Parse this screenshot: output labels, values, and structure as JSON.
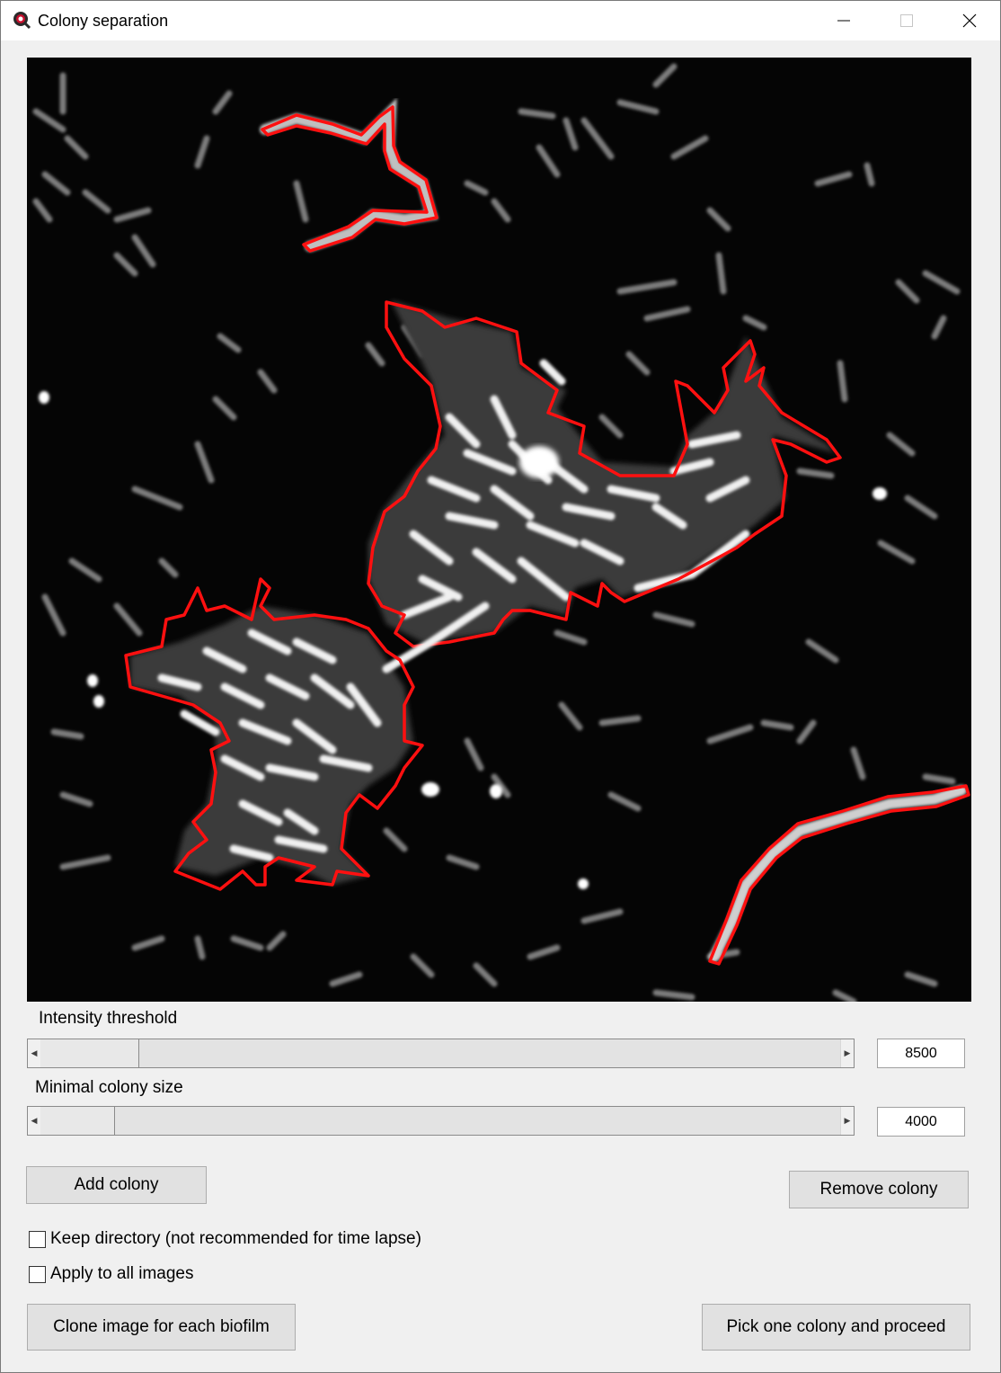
{
  "window": {
    "title": "Colony separation",
    "minimize_icon": "minimize-icon",
    "maximize_icon": "maximize-icon",
    "close_icon": "close-icon",
    "app_icon": "app-logo-icon"
  },
  "image_view": {
    "description_icon": "microscopy-image",
    "outline_color": "#ff0000"
  },
  "controls": {
    "intensity_label": "Intensity threshold",
    "intensity_value": "8500",
    "intensity_fraction": 0.06,
    "size_label": "Minimal colony size",
    "size_value": "4000",
    "size_fraction": 0.03
  },
  "buttons": {
    "add_colony": "Add colony",
    "remove_colony": "Remove colony",
    "clone_image": "Clone image for each biofilm",
    "pick_colony": "Pick one colony and proceed"
  },
  "options": {
    "keep_directory": "Keep directory (not recommended for time lapse)",
    "keep_directory_checked": false,
    "apply_all": "Apply to all images",
    "apply_all_checked": false
  }
}
